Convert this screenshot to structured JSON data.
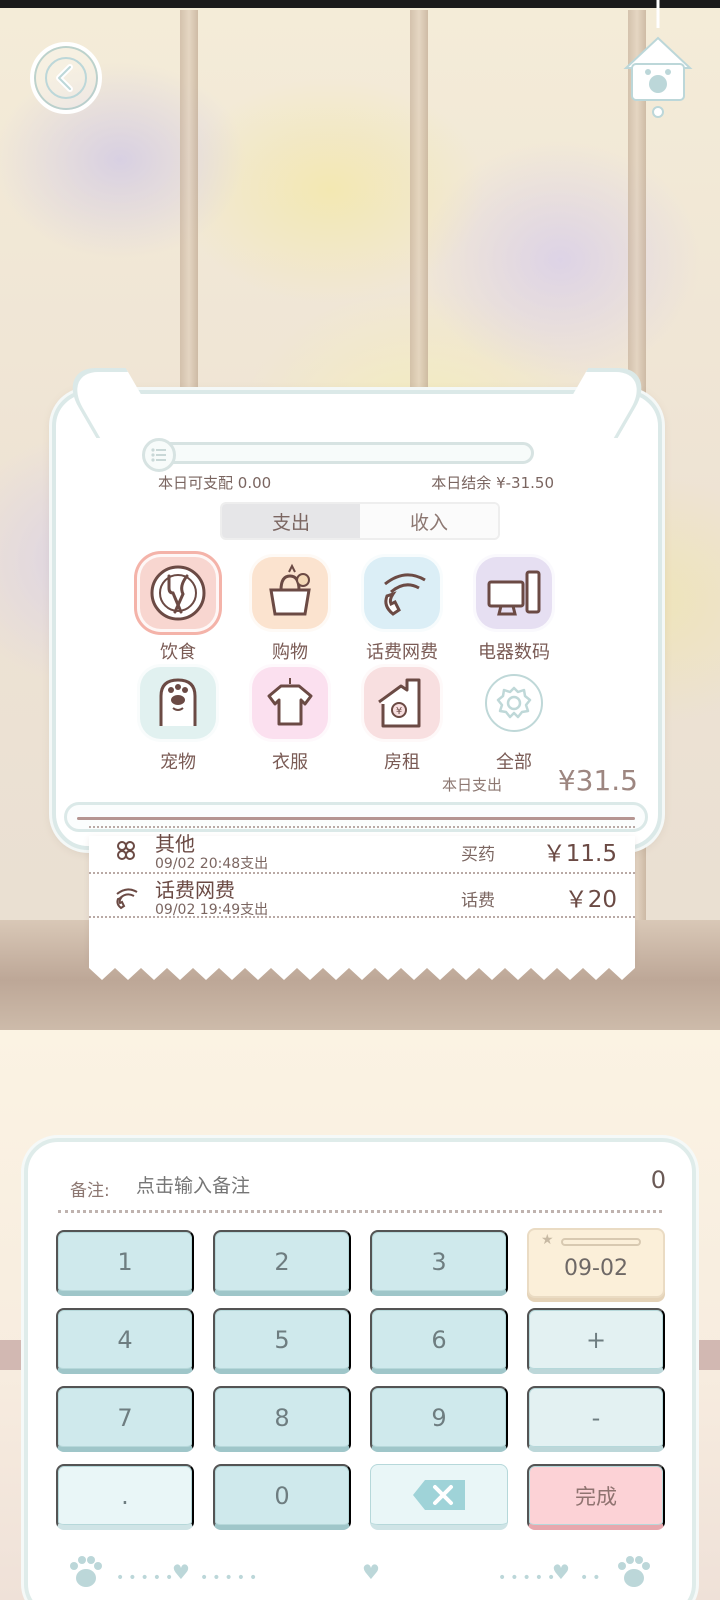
{
  "budget": {
    "available_label": "本日可支配",
    "available_value": "0.00",
    "balance_label": "本日结余",
    "balance_value": "¥-31.50"
  },
  "tabs": [
    {
      "label": "支出",
      "active": true
    },
    {
      "label": "收入",
      "active": false
    }
  ],
  "categories": [
    {
      "label": "饮食",
      "icon": "utensils-icon",
      "color": "#f8d6d0",
      "selected": true
    },
    {
      "label": "购物",
      "icon": "shopping-bag-icon",
      "color": "#fbe3cf",
      "selected": false
    },
    {
      "label": "话费网费",
      "icon": "phone-wifi-icon",
      "color": "#dbeef6",
      "selected": false
    },
    {
      "label": "电器数码",
      "icon": "computer-icon",
      "color": "#e6dff2",
      "selected": false
    },
    {
      "label": "宠物",
      "icon": "pet-icon",
      "color": "#e1f1f0",
      "selected": false
    },
    {
      "label": "衣服",
      "icon": "clothes-icon",
      "color": "#fbe0ef",
      "selected": false
    },
    {
      "label": "房租",
      "icon": "house-rent-icon",
      "color": "#f8dfe0",
      "selected": false
    },
    {
      "label": "全部",
      "icon": "gear-icon",
      "color": "#ffffff",
      "selected": false
    }
  ],
  "today": {
    "label": "本日支出",
    "amount": "¥31.5"
  },
  "records": [
    {
      "category": "其他",
      "time": "09/02 20:48支出",
      "note": "买药",
      "amount": "￥11.5",
      "icon": "other-icon"
    },
    {
      "category": "话费网费",
      "time": "09/02 19:49支出",
      "note": "话费",
      "amount": "￥20",
      "icon": "phone-wifi-icon"
    }
  ],
  "entry": {
    "note_label": "备注:",
    "note_placeholder": "点击输入备注",
    "amount": "0"
  },
  "keypad": {
    "k1": "1",
    "k2": "2",
    "k3": "3",
    "k4": "4",
    "k5": "5",
    "k6": "6",
    "k7": "7",
    "k8": "8",
    "k9": "9",
    "dot": ".",
    "k0": "0",
    "plus": "+",
    "minus": "-",
    "date": "09-02",
    "done": "完成"
  },
  "colors": {
    "accent_teal": "#cfe9ec",
    "done_pink": "#fcd2d6",
    "text_brown": "#6b4a44"
  }
}
